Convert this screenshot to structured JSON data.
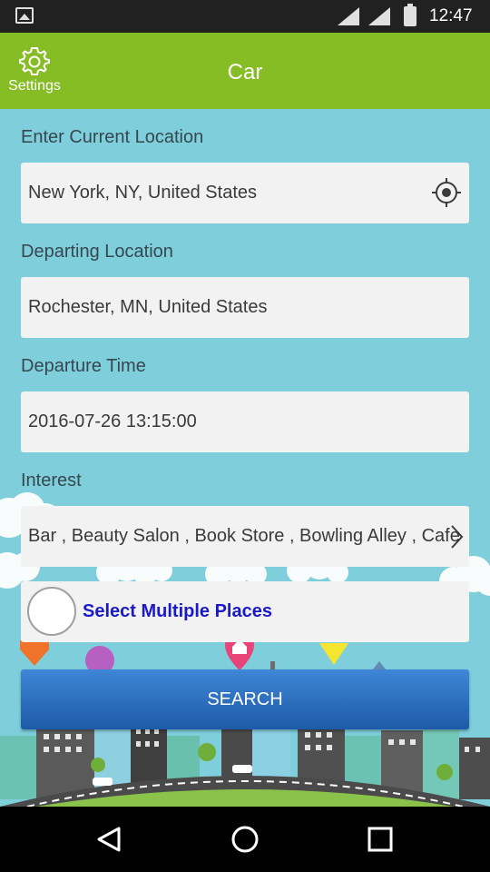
{
  "status_bar": {
    "time": "12:47",
    "icons": [
      "image-icon",
      "signal-icon",
      "signal-icon",
      "battery-icon"
    ]
  },
  "app_bar": {
    "title": "Car",
    "settings_label": "Settings",
    "color": "#86bc24"
  },
  "form": {
    "current_location": {
      "label": "Enter Current Location",
      "value": "New York, NY, United States",
      "icon": "gps-target-icon"
    },
    "departing_location": {
      "label": "Departing Location",
      "value": "Rochester, MN, United States"
    },
    "departure_time": {
      "label": "Departure Time",
      "value": "2016-07-26 13:15:00"
    },
    "interest": {
      "label": "Interest",
      "value": "Bar , Beauty Salon , Book Store , Bowling Alley , Cafe",
      "icon": "chevron-right-icon"
    },
    "select_multiple": {
      "label": "Select Multiple Places",
      "checked": false
    },
    "search_button": "SEARCH"
  },
  "colors": {
    "sky": "#7ecfdb",
    "search_button": "#2a6fc0",
    "multi_label": "#1a1ac8"
  },
  "nav_bar": {
    "buttons": [
      "back-icon",
      "home-icon",
      "recents-icon"
    ]
  }
}
